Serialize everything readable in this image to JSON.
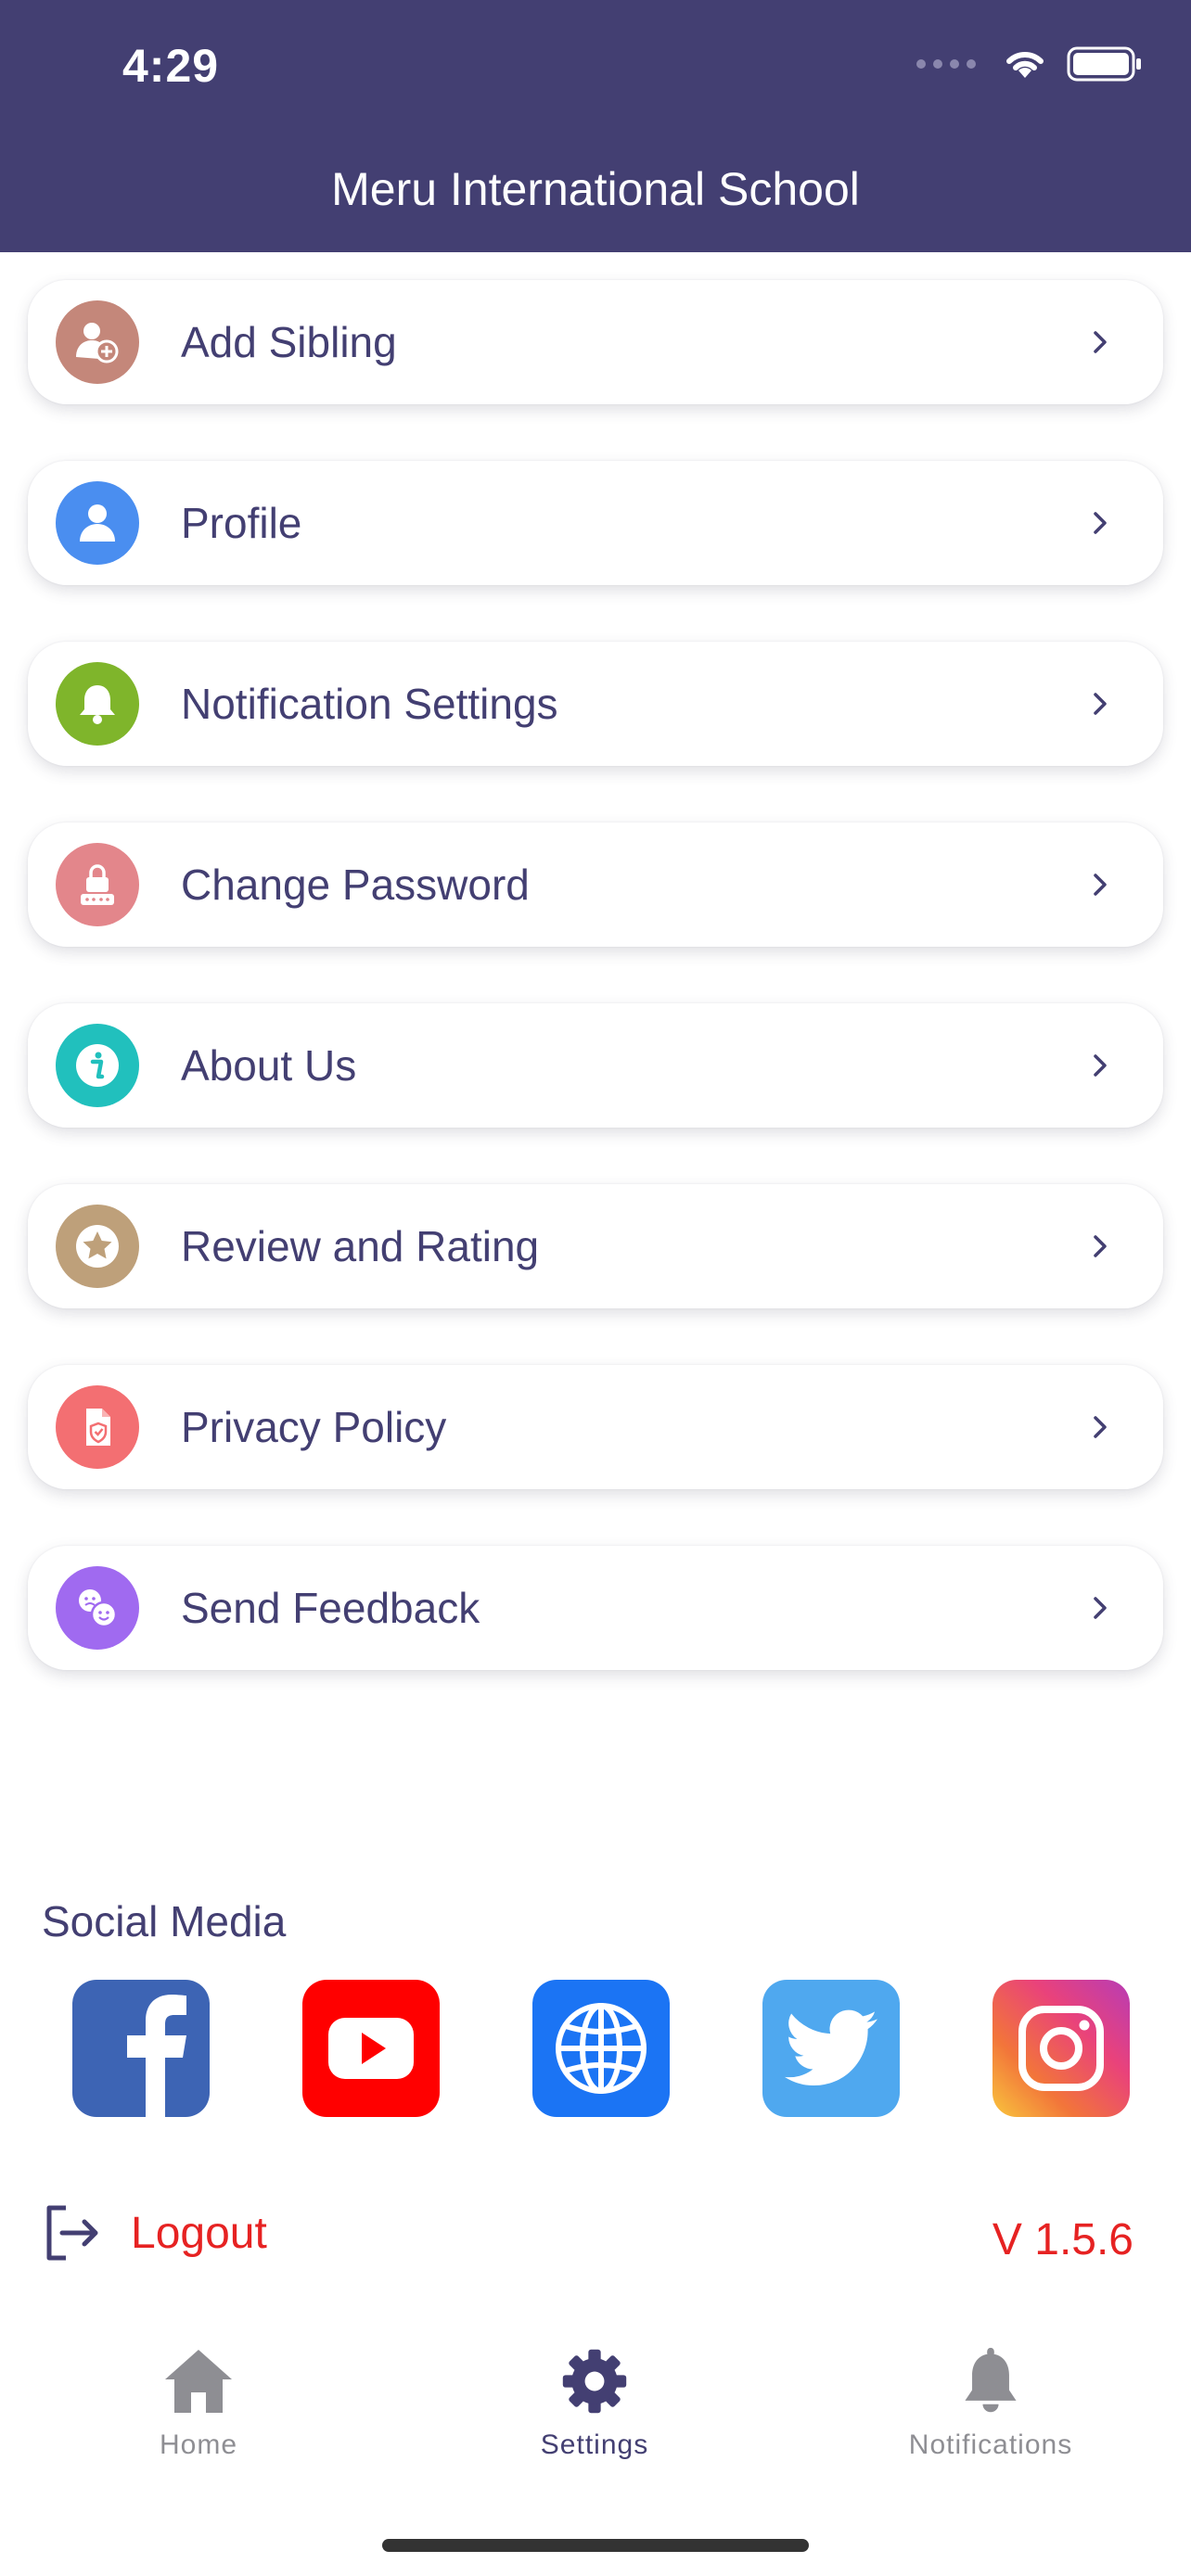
{
  "status_bar": {
    "time": "4:29"
  },
  "header": {
    "title": "Meru International School"
  },
  "menu": {
    "items": [
      {
        "label": "Add Sibling",
        "icon": "add-user-icon",
        "color": "#c4877a"
      },
      {
        "label": "Profile",
        "icon": "person-icon",
        "color": "#4a8ef0"
      },
      {
        "label": "Notification Settings",
        "icon": "bell-icon",
        "color": "#7fb52b"
      },
      {
        "label": "Change Password",
        "icon": "lock-icon",
        "color": "#e3868b"
      },
      {
        "label": "About Us",
        "icon": "info-icon",
        "color": "#21c0bd"
      },
      {
        "label": "Review and Rating",
        "icon": "star-icon",
        "color": "#bea07a"
      },
      {
        "label": "Privacy Policy",
        "icon": "shield-document-icon",
        "color": "#f36f72"
      },
      {
        "label": "Send Feedback",
        "icon": "feedback-icon",
        "color": "#a06af0"
      }
    ]
  },
  "social": {
    "title": "Social Media",
    "links": [
      {
        "name": "facebook",
        "icon": "facebook-icon",
        "color": "#3d64b4"
      },
      {
        "name": "youtube",
        "icon": "youtube-icon",
        "color": "#ff0000"
      },
      {
        "name": "website",
        "icon": "globe-icon",
        "color": "#1b74f4"
      },
      {
        "name": "twitter",
        "icon": "twitter-icon",
        "color": "#4fa8ef"
      },
      {
        "name": "instagram",
        "icon": "instagram-icon",
        "color": "#e9427b"
      }
    ]
  },
  "footer": {
    "logout_label": "Logout",
    "version": "V 1.5.6",
    "accent": "#e62222"
  },
  "tabbar": {
    "tabs": [
      {
        "label": "Home",
        "icon": "home-icon",
        "active": false
      },
      {
        "label": "Settings",
        "icon": "gear-icon",
        "active": true
      },
      {
        "label": "Notifications",
        "icon": "bell-icon",
        "active": false
      }
    ]
  }
}
